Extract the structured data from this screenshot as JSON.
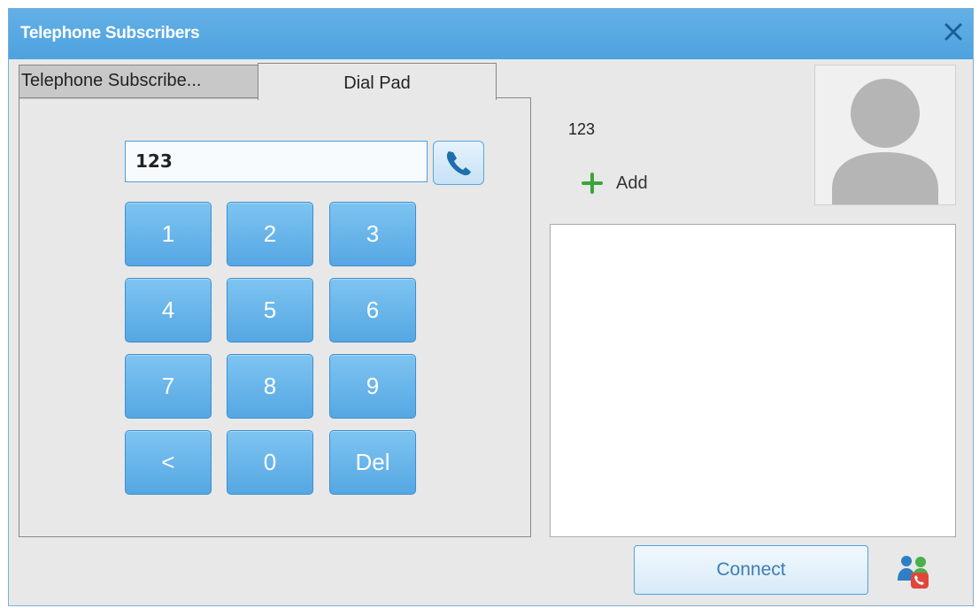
{
  "window": {
    "title": "Telephone Subscribers"
  },
  "tabs": [
    {
      "label": "Telephone Subscribe...",
      "active": false
    },
    {
      "label": "Dial Pad",
      "active": true
    }
  ],
  "dial_input": {
    "value": "123"
  },
  "keypad": [
    "1",
    "2",
    "3",
    "4",
    "5",
    "6",
    "7",
    "8",
    "9",
    "<",
    "0",
    "Del"
  ],
  "subscriber": {
    "number": "123",
    "add_label": "Add"
  },
  "notes_box": {
    "value": ""
  },
  "connect_label": "Connect",
  "colors": {
    "titlebar": "#55a7e3",
    "accent": "#4ea2df",
    "key": "#6bb8ec",
    "add": "#3aa53a"
  },
  "icons": {
    "close": "close-icon",
    "call": "phone-icon",
    "add": "plus-icon",
    "avatar": "user-avatar-icon",
    "users": "users-call-icon"
  }
}
